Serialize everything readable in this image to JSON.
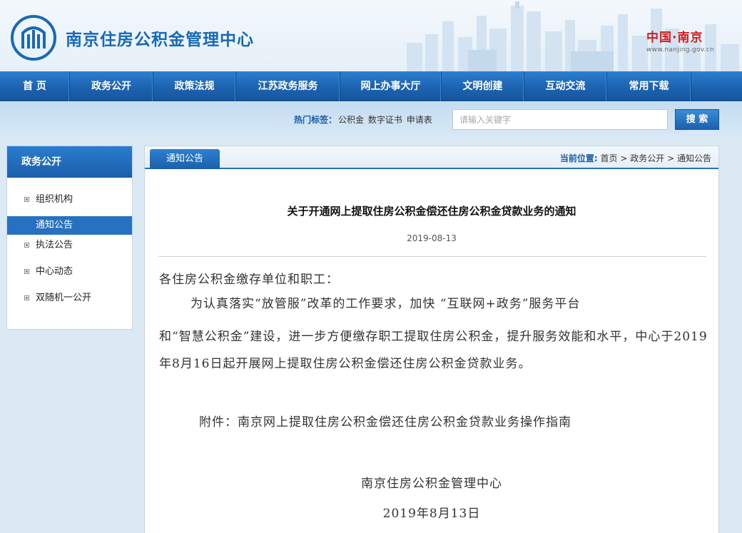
{
  "header": {
    "site_title": "南京住房公积金管理中心",
    "brand_main": "中国·南京",
    "brand_url": "www.nanjing.gov.cn"
  },
  "nav": {
    "items": [
      "首 页",
      "政务公开",
      "政策法规",
      "江苏政务服务",
      "网上办事大厅",
      "文明创建",
      "互动交流",
      "常用下载"
    ]
  },
  "search": {
    "tags_label": "热门标签：",
    "tags": [
      "公积金",
      "数字证书",
      "申请表"
    ],
    "placeholder": "请输入关键字",
    "button": "搜 索"
  },
  "sidebar": {
    "title": "政务公开",
    "items": [
      {
        "label": "组织机构",
        "active": false
      },
      {
        "label": "通知公告",
        "active": true
      },
      {
        "label": "执法公告",
        "active": false
      },
      {
        "label": "中心动态",
        "active": false
      },
      {
        "label": "双随机一公开",
        "active": false
      }
    ]
  },
  "main": {
    "tab": "通知公告",
    "breadcrumb": {
      "label": "当前位置:",
      "items": [
        "首页",
        "政务公开",
        "通知公告"
      ],
      "separator": ">"
    },
    "title": "关于开通网上提取住房公积金偿还住房公积金贷款业务的通知",
    "date": "2019-08-13",
    "salutation": "各住房公积金缴存单位和职工：",
    "para_line1": "为认真落实“放管服”改革的工作要求，加快 “互联网+政务”服务平台",
    "para_rest": "和“智慧公积金”建设，进一步方便缴存职工提取住房公积金，提升服务效能和水平，中心于2019年8月16日起开展网上提取住房公积金偿还住房公积金贷款业务。",
    "attachment": "附件：南京网上提取住房公积金偿还住房公积金贷款业务操作指南",
    "signature_org": "南京住房公积金管理中心",
    "signature_date": "2019年8月13日"
  },
  "colors": {
    "nav_blue": "#1c63b1",
    "title_blue": "#1a69b4",
    "brand_red": "#d11f1f",
    "page_bg": "#dbe9f5"
  }
}
